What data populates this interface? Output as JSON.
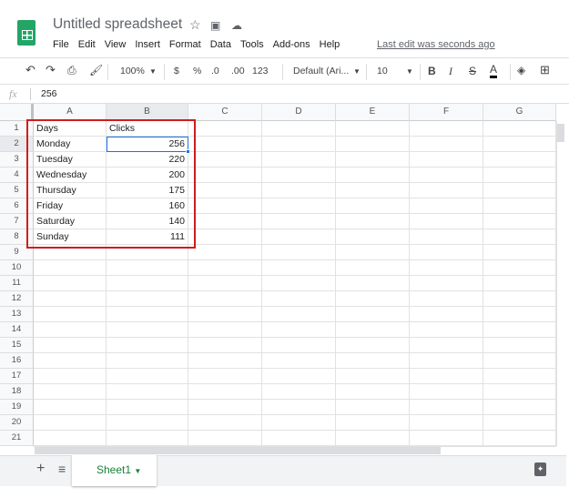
{
  "app": {
    "title": "Untitled spreadsheet",
    "last_edit": "Last edit was seconds ago",
    "menu": [
      "File",
      "Edit",
      "View",
      "Insert",
      "Format",
      "Data",
      "Tools",
      "Add-ons",
      "Help"
    ]
  },
  "toolbar": {
    "zoom": "100%",
    "currency": "$",
    "percent": "%",
    "dec_decrease": ".0",
    "dec_increase": ".00",
    "format_more": "123",
    "font": "Default (Ari...",
    "font_size": "10",
    "bold": "B",
    "italic": "I",
    "strike": "S",
    "text_color": "A"
  },
  "formula_bar": {
    "fx": "fx",
    "value": "256"
  },
  "columns": [
    "A",
    "B",
    "C",
    "D",
    "E",
    "F",
    "G"
  ],
  "row_count": 21,
  "cells": [
    [
      "Days",
      "Clicks"
    ],
    [
      "Monday",
      "256"
    ],
    [
      "Tuesday",
      "220"
    ],
    [
      "Wednesday",
      "200"
    ],
    [
      "Thursday",
      "175"
    ],
    [
      "Friday",
      "160"
    ],
    [
      "Saturday",
      "140"
    ],
    [
      "Sunday",
      "111"
    ]
  ],
  "selected_cell": "B2",
  "sheets": [
    {
      "label": "Sheet1",
      "active": true
    }
  ],
  "colors": {
    "accent": "#1a73e8",
    "highlight_box": "#d21c1c",
    "sheet_tab": "#188038"
  }
}
